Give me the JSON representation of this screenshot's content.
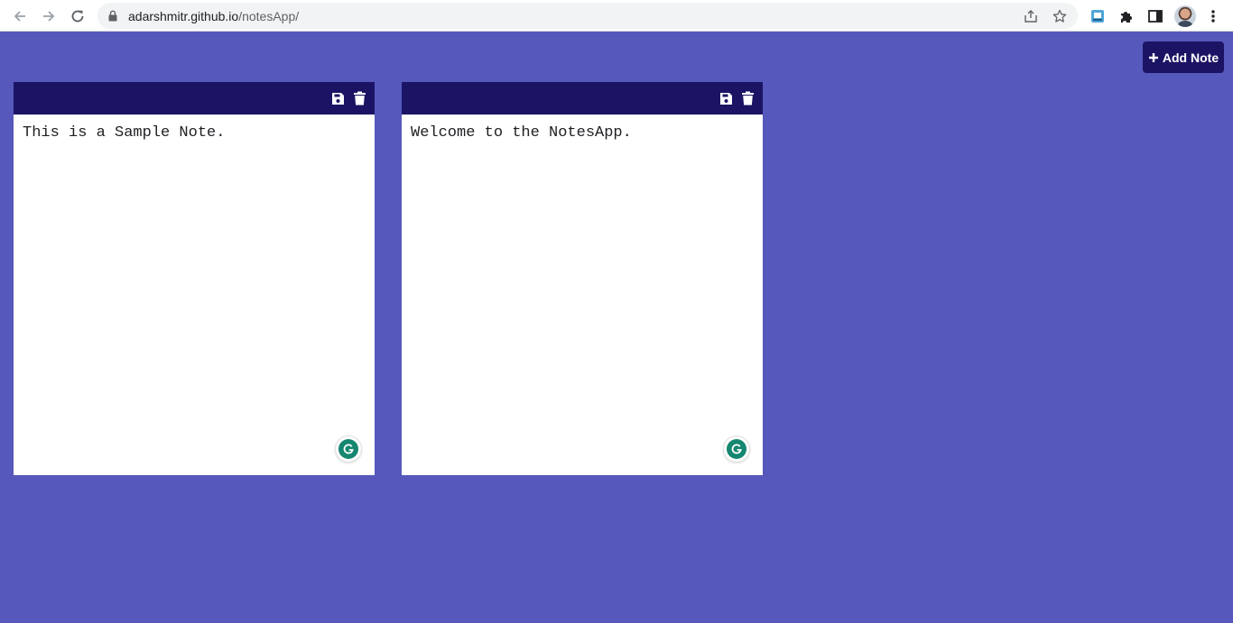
{
  "browser": {
    "url_host": "adarshmitr.github.io",
    "url_path": "/notesApp/"
  },
  "app": {
    "add_note_label": "Add Note",
    "add_note_icon": "plus-icon",
    "colors": {
      "background": "#5658bc",
      "toolbar": "#1b1464",
      "note": "#ffffff",
      "grammarly": "#15866f"
    }
  },
  "notes": [
    {
      "text": "This is a Sample Note.",
      "save_icon": "save-icon",
      "delete_icon": "trash-icon"
    },
    {
      "text": "Welcome to the NotesApp.",
      "save_icon": "save-icon",
      "delete_icon": "trash-icon"
    }
  ]
}
